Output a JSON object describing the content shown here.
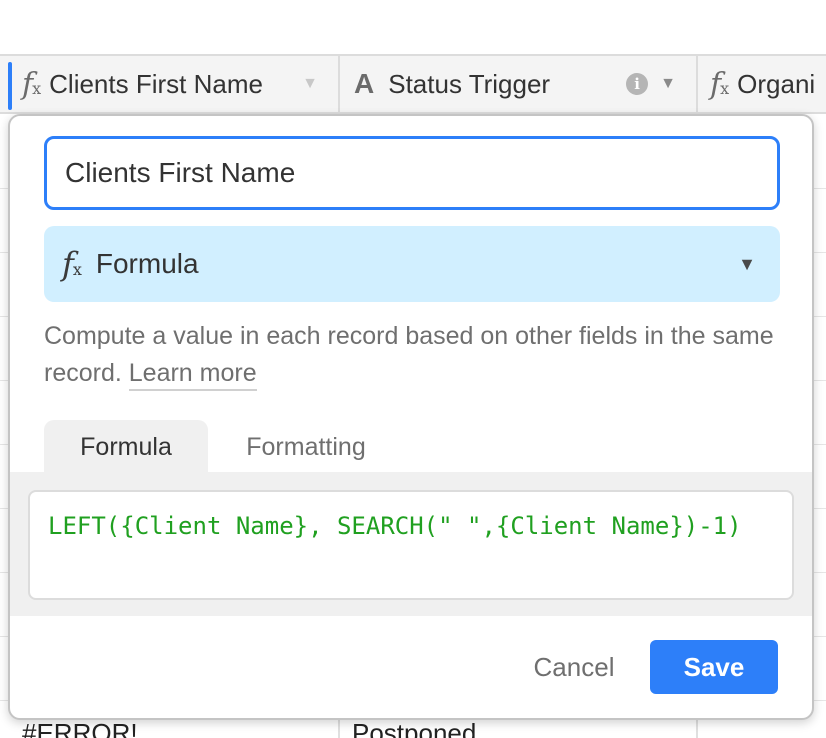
{
  "grid": {
    "columns": [
      {
        "label": "Clients First Name",
        "icon": "formula-icon"
      },
      {
        "label": "Status Trigger",
        "icon": "text-field-icon"
      },
      {
        "label": "Organi",
        "icon": "formula-icon"
      }
    ],
    "visible_cells": {
      "clients_first_name": "#ERROR!",
      "status_trigger": "Postponed"
    }
  },
  "field_editor": {
    "field_name": "Clients First Name",
    "field_type": {
      "icon": "formula-icon",
      "label": "Formula"
    },
    "description": "Compute a value in each record based on other fields in the same record.",
    "learn_more": "Learn more",
    "tabs": [
      {
        "label": "Formula",
        "active": true
      },
      {
        "label": "Formatting",
        "active": false
      }
    ],
    "formula": "LEFT({Client Name}, SEARCH(\" \",{Client Name})-1)",
    "cancel_label": "Cancel",
    "save_label": "Save"
  },
  "colors": {
    "accent": "#2d7ff9",
    "type_select_bg": "#d1efff",
    "formula_text": "#20a020"
  }
}
